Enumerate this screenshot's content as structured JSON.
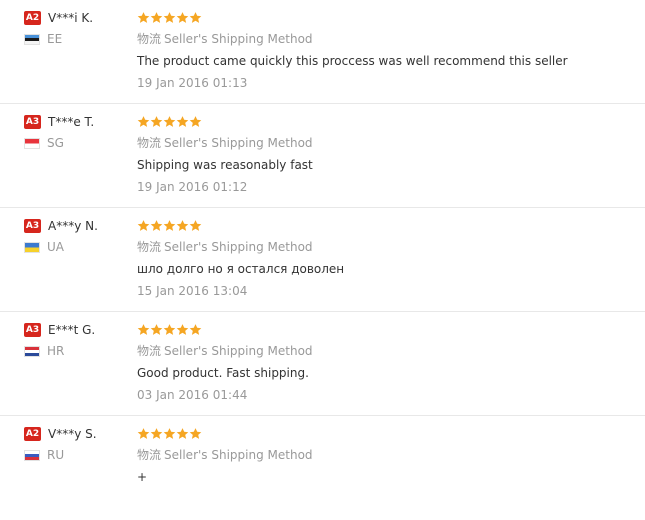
{
  "reviews": [
    {
      "level": "A2",
      "buyer": "V***i K.",
      "country": "EE",
      "flag": "estonia-flag",
      "rating": 5,
      "shipping_cn": "物流",
      "shipping_method": "Seller's Shipping Method",
      "feedback": "The product came quickly this proccess was well recommend this seller",
      "date": "19 Jan 2016 01:13"
    },
    {
      "level": "A3",
      "buyer": "T***e T.",
      "country": "SG",
      "flag": "singapore-flag",
      "rating": 5,
      "shipping_cn": "物流",
      "shipping_method": "Seller's Shipping Method",
      "feedback": "Shipping was reasonably fast",
      "date": "19 Jan 2016 01:12"
    },
    {
      "level": "A3",
      "buyer": "A***y N.",
      "country": "UA",
      "flag": "ukraine-flag",
      "rating": 5,
      "shipping_cn": "物流",
      "shipping_method": "Seller's Shipping Method",
      "feedback": "шло долго но я остался доволен",
      "date": "15 Jan 2016 13:04"
    },
    {
      "level": "A3",
      "buyer": "E***t G.",
      "country": "HR",
      "flag": "croatia-flag",
      "rating": 5,
      "shipping_cn": "物流",
      "shipping_method": "Seller's Shipping Method",
      "feedback": "Good product. Fast shipping.",
      "date": "03 Jan 2016 01:44"
    },
    {
      "level": "A2",
      "buyer": "V***y S.",
      "country": "RU",
      "flag": "russia-flag",
      "rating": 5,
      "shipping_cn": "物流",
      "shipping_method": "Seller's Shipping Method",
      "feedback": "+",
      "date": ""
    }
  ],
  "colors": {
    "badge": "#d6261d",
    "star": "#f5a623",
    "muted_text": "#999999",
    "text": "#333333",
    "divider": "#e8e8e8"
  }
}
